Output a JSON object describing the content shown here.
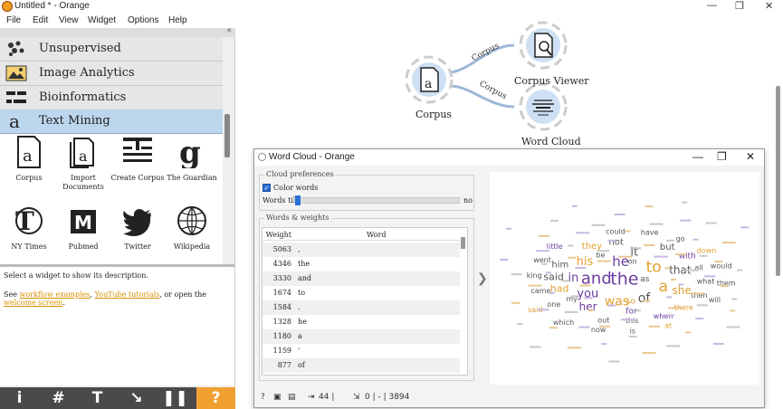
{
  "window": {
    "title": "Untitled * - Orange",
    "min": "—",
    "max": "❐",
    "close": "✕"
  },
  "menu": [
    "File",
    "Edit",
    "View",
    "Widget",
    "Options",
    "Help"
  ],
  "sidebar": {
    "collapse": "«",
    "categories": [
      {
        "label": "Unsupervised",
        "icon": "unsupervised-icon"
      },
      {
        "label": "Image Analytics",
        "icon": "image-icon"
      },
      {
        "label": "Bioinformatics",
        "icon": "bioinformatics-icon"
      },
      {
        "label": "Text Mining",
        "icon": "text-mining-icon",
        "active": true
      }
    ],
    "widgets": [
      {
        "label": "Corpus",
        "icon": "corpus-icon"
      },
      {
        "label": "Import Documents",
        "icon": "import-documents-icon"
      },
      {
        "label": "Create Corpus",
        "icon": "create-corpus-icon"
      },
      {
        "label": "The Guardian",
        "icon": "guardian-icon"
      },
      {
        "label": "NY Times",
        "icon": "nytimes-icon"
      },
      {
        "label": "Pubmed",
        "icon": "pubmed-icon"
      },
      {
        "label": "Twitter",
        "icon": "twitter-icon"
      },
      {
        "label": "Wikipedia",
        "icon": "wikipedia-icon"
      }
    ],
    "description": {
      "line1": "Select a widget to show its description.",
      "see": "See",
      "link1": "workflow examples",
      "comma": ",",
      "link2": "YouTube tutorials",
      "or": ", or open the",
      "link3": "welcome screen",
      "dot": "."
    },
    "toolbar": [
      "i",
      "#",
      "T",
      "↘",
      "❚❚",
      "?"
    ]
  },
  "canvas": {
    "nodes": {
      "corpus": "Corpus",
      "viewer": "Corpus Viewer",
      "wordcloud": "Word Cloud"
    },
    "links": [
      "Corpus",
      "Corpus"
    ]
  },
  "wordcloud_window": {
    "title": "Word Cloud - Orange",
    "prefs_label": "Cloud preferences",
    "color_words": "Color words",
    "words_tilt": "Words tilt:",
    "tilt_value_label": "no",
    "weights_label": "Words & weights",
    "col_weight": "Weight",
    "col_word": "Word",
    "rows": [
      {
        "weight": "5063",
        "word": ","
      },
      {
        "weight": "4346",
        "word": "the"
      },
      {
        "weight": "3330",
        "word": "and"
      },
      {
        "weight": "1674",
        "word": "to"
      },
      {
        "weight": "1584",
        "word": "."
      },
      {
        "weight": "1328",
        "word": "he"
      },
      {
        "weight": "1180",
        "word": "a"
      },
      {
        "weight": "1159",
        "word": "'"
      },
      {
        "weight": "877",
        "word": "of"
      }
    ],
    "cloud_words": [
      {
        "text": "the",
        "size": 15,
        "color": "#6a3da0"
      },
      {
        "text": "and",
        "size": 14,
        "color": "#6a3da0"
      },
      {
        "text": "to",
        "size": 13,
        "color": "#e0a030"
      },
      {
        "text": "he",
        "size": 11,
        "color": "#6a3da0"
      },
      {
        "text": "a",
        "size": 13,
        "color": "#e0a030"
      },
      {
        "text": "of",
        "size": 10,
        "color": "#555"
      },
      {
        "text": "was",
        "size": 10,
        "color": "#e0a030"
      },
      {
        "text": "you",
        "size": 9,
        "color": "#6a3da0"
      },
      {
        "text": "his",
        "size": 9,
        "color": "#e0a030"
      },
      {
        "text": "in",
        "size": 9,
        "color": "#6a3da0"
      },
      {
        "text": "it",
        "size": 9,
        "color": "#555"
      },
      {
        "text": "that",
        "size": 8,
        "color": "#555"
      },
      {
        "text": "she",
        "size": 8,
        "color": "#e0a030"
      },
      {
        "text": "her",
        "size": 8,
        "color": "#6a3da0"
      },
      {
        "text": "said",
        "size": 7,
        "color": "#555"
      },
      {
        "text": "had",
        "size": 7,
        "color": "#e0a030"
      },
      {
        "text": "him",
        "size": 6,
        "color": "#555"
      },
      {
        "text": "they",
        "size": 6,
        "color": "#e0a030"
      },
      {
        "text": "not",
        "size": 6,
        "color": "#555"
      },
      {
        "text": "but",
        "size": 6,
        "color": "#555"
      },
      {
        "text": "with",
        "size": 5,
        "color": "#6a3da0"
      },
      {
        "text": "as",
        "size": 5,
        "color": "#555"
      },
      {
        "text": "so",
        "size": 5,
        "color": "#e0a030"
      },
      {
        "text": "for",
        "size": 5,
        "color": "#6a3da0"
      },
      {
        "text": "what",
        "size": 4,
        "color": "#555"
      },
      {
        "text": "on",
        "size": 4,
        "color": "#555"
      },
      {
        "text": "be",
        "size": 4,
        "color": "#555"
      },
      {
        "text": "then",
        "size": 4,
        "color": "#555"
      },
      {
        "text": "my",
        "size": 4,
        "color": "#555"
      },
      {
        "text": "all",
        "size": 4,
        "color": "#555"
      },
      {
        "text": "there",
        "size": 4,
        "color": "#e0a030"
      },
      {
        "text": "when",
        "size": 4,
        "color": "#6a3da0"
      },
      {
        "text": "this",
        "size": 4,
        "color": "#555"
      },
      {
        "text": "out",
        "size": 4,
        "color": "#555"
      },
      {
        "text": "one",
        "size": 4,
        "color": "#555"
      },
      {
        "text": "came",
        "size": 4,
        "color": "#555"
      },
      {
        "text": "little",
        "size": 4,
        "color": "#6a3da0"
      },
      {
        "text": "king",
        "size": 4,
        "color": "#555"
      },
      {
        "text": "went",
        "size": 4,
        "color": "#555"
      },
      {
        "text": "could",
        "size": 4,
        "color": "#555"
      },
      {
        "text": "have",
        "size": 4,
        "color": "#555"
      },
      {
        "text": "down",
        "size": 4,
        "color": "#e0a030"
      },
      {
        "text": "would",
        "size": 4,
        "color": "#555"
      },
      {
        "text": "them",
        "size": 4,
        "color": "#555"
      },
      {
        "text": "go",
        "size": 4,
        "color": "#555"
      },
      {
        "text": "will",
        "size": 4,
        "color": "#555"
      },
      {
        "text": "at",
        "size": 4,
        "color": "#e0a030"
      },
      {
        "text": "is",
        "size": 4,
        "color": "#555"
      },
      {
        "text": "now",
        "size": 4,
        "color": "#555"
      },
      {
        "text": "which",
        "size": 4,
        "color": "#555"
      },
      {
        "text": "said",
        "size": 4,
        "color": "#e0a030"
      }
    ]
  },
  "status": {
    "in": "44 |",
    "out": "0 | - | 3894"
  },
  "colors": {
    "accent": "#2a6fd6",
    "orange": "#f0a030",
    "purple": "#6a3da0"
  }
}
